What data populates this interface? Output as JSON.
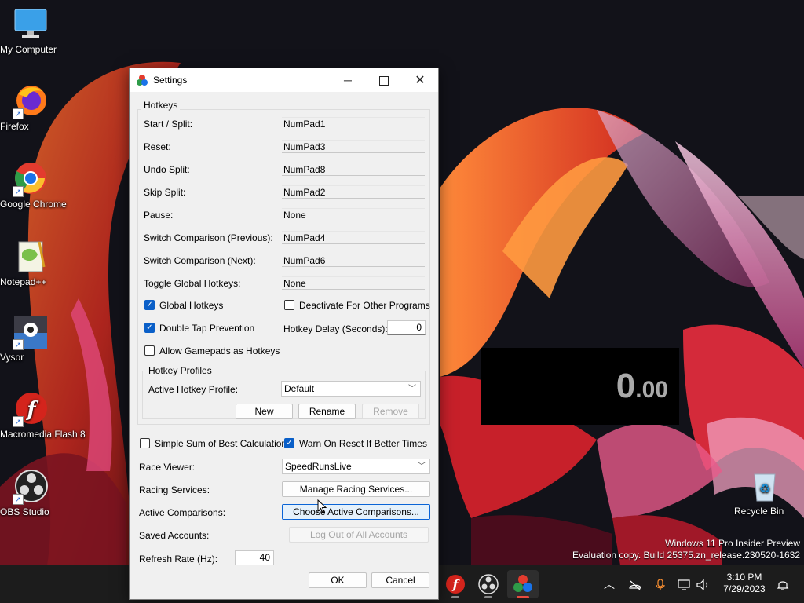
{
  "desktop": {
    "icons": [
      {
        "label": "My Computer"
      },
      {
        "label": "Firefox"
      },
      {
        "label": "Google Chrome"
      },
      {
        "label": "Notepad++"
      },
      {
        "label": "Vysor"
      },
      {
        "label": "Macromedia Flash 8"
      },
      {
        "label": "OBS Studio"
      },
      {
        "label": "Recycle Bin"
      }
    ]
  },
  "timer": {
    "whole": "0",
    "fraction": ".00",
    "color": "#a9a9a9"
  },
  "watermark": {
    "line1": "Windows 11 Pro Insider Preview",
    "line2": "Evaluation copy. Build 25375.zn_release.230520-1632"
  },
  "taskbar": {
    "clock_time": "3:10 PM",
    "clock_date": "7/29/2023",
    "apps": [
      "flash-app-icon",
      "obs-app-icon",
      "livesplit-app-icon"
    ],
    "tray_icons": [
      "chevron-up-icon",
      "network-off-icon",
      "microphone-icon",
      "display-icon",
      "volume-icon",
      "notification-icon"
    ]
  },
  "settings": {
    "title": "Settings",
    "hotkeys": {
      "group_title": "Hotkeys",
      "rows": [
        {
          "label": "Start / Split:",
          "value": "NumPad1"
        },
        {
          "label": "Reset:",
          "value": "NumPad3"
        },
        {
          "label": "Undo Split:",
          "value": "NumPad8"
        },
        {
          "label": "Skip Split:",
          "value": "NumPad2"
        },
        {
          "label": "Pause:",
          "value": "None"
        },
        {
          "label": "Switch Comparison (Previous):",
          "value": "NumPad4"
        },
        {
          "label": "Switch Comparison (Next):",
          "value": "NumPad6"
        },
        {
          "label": "Toggle Global Hotkeys:",
          "value": "None"
        }
      ],
      "global_hotkeys": {
        "label": "Global Hotkeys",
        "checked": true
      },
      "deactivate_other": {
        "label": "Deactivate For Other Programs",
        "checked": false
      },
      "double_tap": {
        "label": "Double Tap Prevention",
        "checked": true
      },
      "hotkey_delay": {
        "label": "Hotkey Delay (Seconds):",
        "value": "0"
      },
      "gamepads": {
        "label": "Allow Gamepads as Hotkeys",
        "checked": false
      },
      "profiles": {
        "group_title": "Hotkey Profiles",
        "active_label": "Active Hotkey Profile:",
        "active_value": "Default",
        "new_label": "New",
        "rename_label": "Rename",
        "remove_label": "Remove"
      }
    },
    "simple_sob": {
      "label": "Simple Sum of Best Calculation",
      "checked": false
    },
    "warn_on_reset": {
      "label": "Warn On Reset If Better Times",
      "checked": true
    },
    "race_viewer": {
      "label": "Race Viewer:",
      "value": "SpeedRunsLive"
    },
    "racing_services": {
      "label": "Racing Services:",
      "button": "Manage Racing Services..."
    },
    "active_comparisons": {
      "label": "Active Comparisons:",
      "button": "Choose Active Comparisons..."
    },
    "saved_accounts": {
      "label": "Saved Accounts:",
      "button": "Log Out of All Accounts"
    },
    "refresh_rate": {
      "label": "Refresh Rate (Hz):",
      "value": "40"
    },
    "ok_label": "OK",
    "cancel_label": "Cancel"
  }
}
